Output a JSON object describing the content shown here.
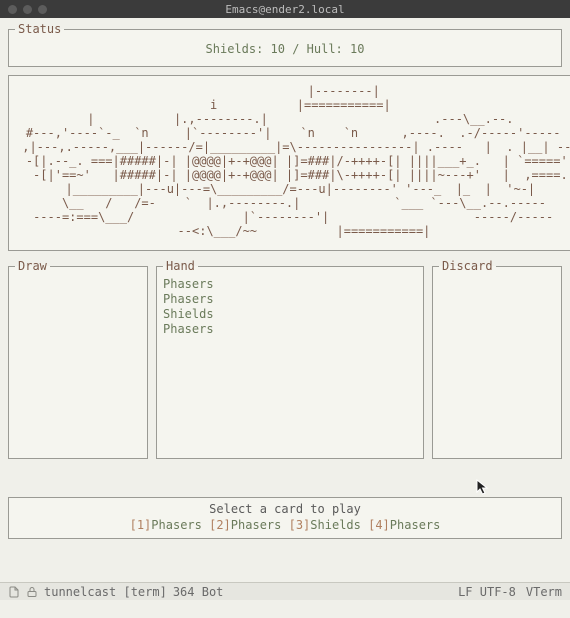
{
  "window": {
    "title": "Emacs@ender2.local"
  },
  "status": {
    "legend": "Status",
    "line": "Shields: 10  /  Hull: 10"
  },
  "art": "              |--------|\n  i           |===========|\n  |           |.,--------.|                       .---\\__.--.\n#---,'----`-_  `n     |`--------'|    `n    `n      ,----.  .-/-----'-----\n ,|---,.-----,___|------/=|_________|=\\----------------| .----   |  . |__| --\n -[|.--_. ===|#####|-| |@@@@|+-+@@@| |]=###|/-++++-[| ||||___+_.   | `====='\n  -[|'==~'   |#####|-| |@@@@|+-+@@@| |]=###|\\-++++-[| ||||~---+'   |  ,====.\n  |_________|---u|---=\\_________/=---u|--------' '---_  |_  |  '~-|\n   \\__   /   /=-    `  |.,--------.|             `___ `---\\__.--.-----\n----=:===\\___/               |`--------'|                    -----/-----\n   --<:\\___/~~           |===========|",
  "piles": {
    "draw": {
      "legend": "Draw",
      "cards": []
    },
    "hand": {
      "legend": "Hand",
      "cards": [
        "Phasers",
        "Phasers",
        "Shields",
        "Phasers"
      ]
    },
    "discard": {
      "legend": "Discard",
      "cards": []
    }
  },
  "prompt": {
    "title": "Select a card to play",
    "options": [
      {
        "index": "[1]",
        "label": "Phasers"
      },
      {
        "index": "[2]",
        "label": "Phasers"
      },
      {
        "index": "[3]",
        "label": "Shields"
      },
      {
        "index": "[4]",
        "label": "Phasers"
      }
    ]
  },
  "modeline": {
    "buffer": "tunnelcast [term]",
    "position": "364 Bot",
    "encoding": "LF UTF-8",
    "mode": "VTerm"
  }
}
